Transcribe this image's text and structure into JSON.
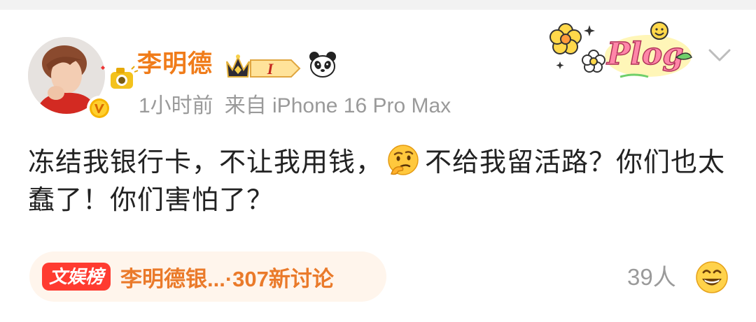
{
  "post": {
    "username": "李明德",
    "vip_level": "I",
    "time": "1小时前",
    "source": "来自 iPhone 16 Pro Max",
    "content_part1": "冻结我银行卡，不让我用钱，",
    "content_part2": "不给我留活路？你们也太蠢了！你们害怕了？",
    "emoji_thinking": "thinking-face-emoji",
    "sticker_text": "Plog"
  },
  "trending": {
    "tag": "文娱榜",
    "title": "李明德银...",
    "count_text": "·307新讨论"
  },
  "footer": {
    "people_count": "39人",
    "reaction_icon": "grinning-face-icon"
  },
  "colors": {
    "username": "#f07c1a",
    "meta": "#9a9a9a",
    "trend_tag_bg": "#ff3b30",
    "trend_pill_bg": "#fff5ec",
    "trend_text": "#ea7a2a"
  }
}
